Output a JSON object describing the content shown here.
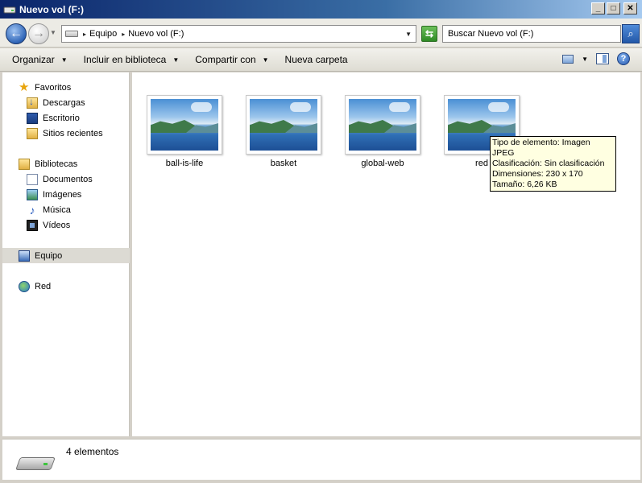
{
  "window": {
    "title": "Nuevo vol (F:)",
    "controls": {
      "minimize": "_",
      "maximize": "□",
      "close": "✕"
    }
  },
  "address": {
    "breadcrumbs": [
      "Equipo",
      "Nuevo vol (F:)"
    ],
    "search_placeholder": "Buscar Nuevo vol (F:)"
  },
  "toolbar": {
    "organize": "Organizar",
    "include": "Incluir en biblioteca",
    "share": "Compartir con",
    "new_folder": "Nueva carpeta"
  },
  "sidebar": {
    "favorites": {
      "label": "Favoritos",
      "items": [
        {
          "label": "Descargas"
        },
        {
          "label": "Escritorio"
        },
        {
          "label": "Sitios recientes"
        }
      ]
    },
    "libraries": {
      "label": "Bibliotecas",
      "items": [
        {
          "label": "Documentos"
        },
        {
          "label": "Imágenes"
        },
        {
          "label": "Música"
        },
        {
          "label": "Vídeos"
        }
      ]
    },
    "computer": {
      "label": "Equipo",
      "selected": true
    },
    "network": {
      "label": "Red"
    }
  },
  "files": [
    {
      "name": "ball-is-life"
    },
    {
      "name": "basket"
    },
    {
      "name": "global-web"
    },
    {
      "name": "red"
    }
  ],
  "tooltip": {
    "lines": [
      "Tipo de elemento: Imagen JPEG",
      "Clasificación: Sin clasificación",
      "Dimensiones: 230 x 170",
      "Tamaño: 6,26 KB"
    ]
  },
  "status": {
    "count_text": "4 elementos"
  }
}
